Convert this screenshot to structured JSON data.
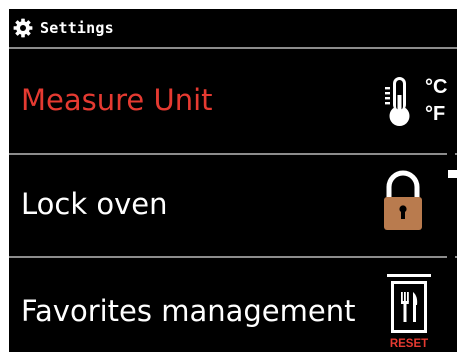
{
  "header": {
    "title": "Settings",
    "icon": "gear-icon"
  },
  "menu": {
    "items": [
      {
        "label": "Measure Unit",
        "icon": "thermometer-icon",
        "selected": true,
        "icon_text_c": "°C",
        "icon_text_f": "°F"
      },
      {
        "label": "Lock oven",
        "icon": "padlock-icon",
        "selected": false
      },
      {
        "label": "Favorites management",
        "icon": "favorites-reset-icon",
        "selected": false,
        "icon_text": "RESET"
      }
    ]
  },
  "colors": {
    "selected_text": "#e53a31",
    "lock_body": "#b97b4e",
    "reset_text": "#e53a31"
  }
}
